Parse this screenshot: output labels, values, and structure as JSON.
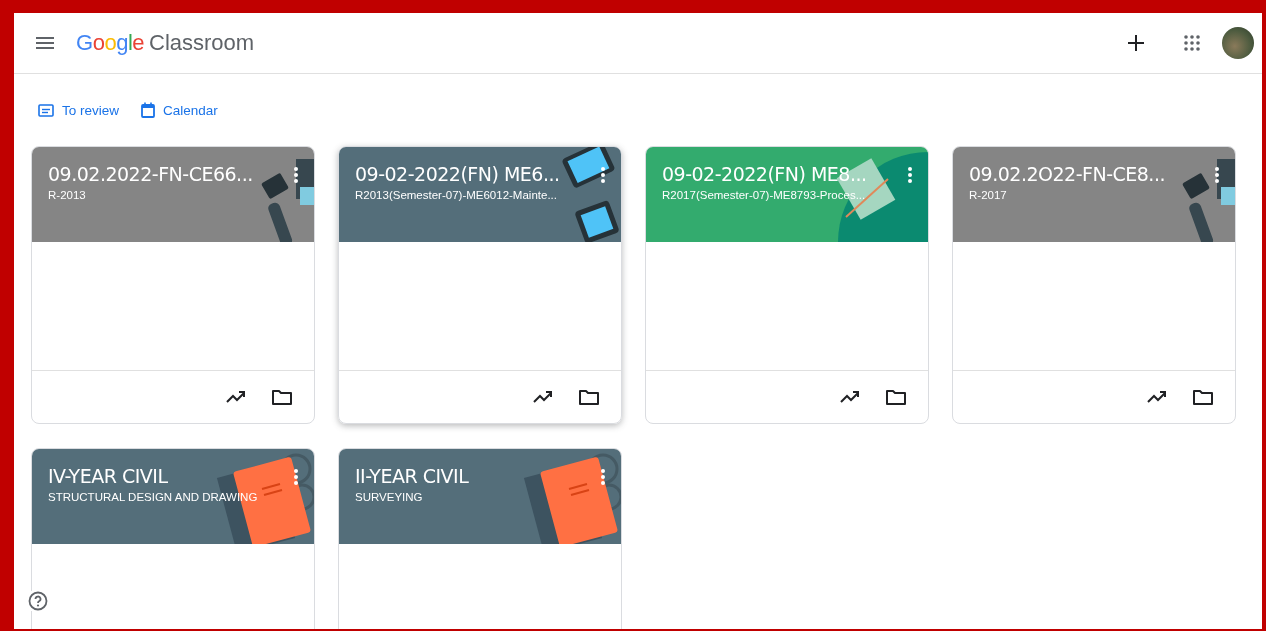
{
  "app_bar": {
    "logo_brand": "Google",
    "logo_product": "Classroom"
  },
  "nav_links": [
    {
      "label": "To review",
      "kind": "review"
    },
    {
      "label": "Calendar",
      "kind": "calendar"
    }
  ],
  "classes": [
    {
      "title": "09.02.2022-FN-CE66...",
      "subtitle": "R-2013",
      "color": "#858585",
      "kind": "pens",
      "hovered": false
    },
    {
      "title": "09-02-2022(FN) ME6...",
      "subtitle": "R2013(Semester-07)-ME6012-Mainte...",
      "color": "#546e7a",
      "kind": "tablets",
      "hovered": true
    },
    {
      "title": "09-02-2022(FN) ME8...",
      "subtitle": "R2017(Semester-07)-ME8793-Proces...",
      "color": "#33ab6e",
      "kind": "notebook",
      "hovered": false
    },
    {
      "title": "09.02.2O22-FN-CE8...",
      "subtitle": "R-2017",
      "color": "#858585",
      "kind": "pens",
      "hovered": false
    },
    {
      "title": "IV-YEAR CIVIL",
      "subtitle": "STRUCTURAL DESIGN AND DRAWING",
      "color": "#546e7a",
      "kind": "book",
      "hovered": false
    },
    {
      "title": "II-YEAR CIVIL",
      "subtitle": "SURVEYING",
      "color": "#546e7a",
      "kind": "book",
      "hovered": false
    }
  ]
}
